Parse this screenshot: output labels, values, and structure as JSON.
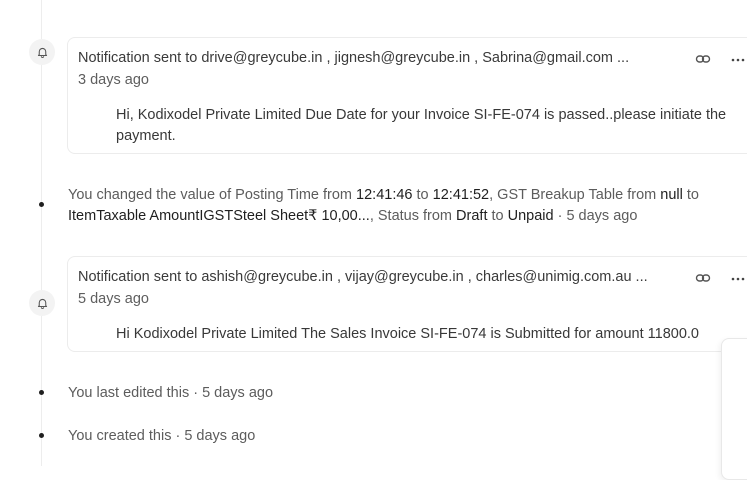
{
  "timeline": [
    {
      "type": "notification",
      "header": "Notification sent to drive@greycube.in , jignesh@greycube.in , Sabrina@gmail.com ...",
      "time": "3 days ago",
      "body": "Hi, Kodixodel Private Limited Due Date for your Invoice SI-FE-074 is passed..please initiate the payment.",
      "icons": [
        "bell-icon",
        "link-icon",
        "more-icon"
      ]
    },
    {
      "type": "change",
      "parts": {
        "p1": "You changed the value of Posting Time from ",
        "from_time": "12:41:46",
        "p2": " to ",
        "to_time": "12:41:52",
        "p3": ", GST Breakup Table from ",
        "from_table": "null",
        "p4": " to",
        "to_table": "ItemTaxable AmountIGSTSteel Sheet₹ 10,00...",
        "p5": ", Status from ",
        "from_status": "Draft",
        "p6": " to ",
        "to_status": "Unpaid",
        "p7": " · 5 days ago"
      }
    },
    {
      "type": "notification",
      "header": "Notification sent to ashish@greycube.in , vijay@greycube.in , charles@unimig.com.au ...",
      "time": "5 days ago",
      "body": "Hi Kodixodel Private Limited The Sales Invoice SI-FE-074 is Submitted for amount 11800.0",
      "icons": [
        "bell-icon",
        "link-icon",
        "more-icon"
      ]
    },
    {
      "type": "activity",
      "text": "You last edited this · 5 days ago"
    },
    {
      "type": "activity",
      "text": "You created this · 5 days ago"
    }
  ]
}
